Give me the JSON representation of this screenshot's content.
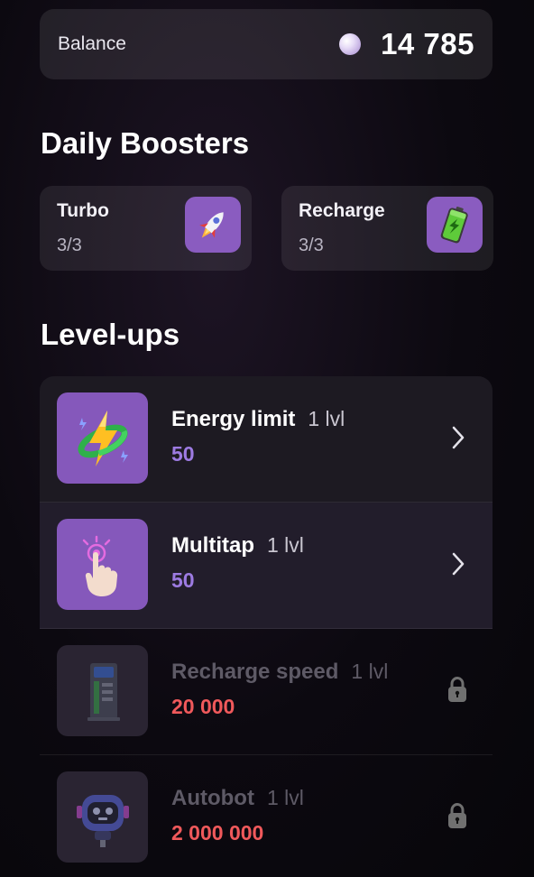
{
  "balance": {
    "label": "Balance",
    "value": "14 785",
    "coin_icon": "pearl-coin-icon"
  },
  "daily_boosters": {
    "title": "Daily Boosters",
    "items": [
      {
        "name": "Turbo",
        "count": "3/3",
        "icon": "rocket-icon"
      },
      {
        "name": "Recharge",
        "count": "3/3",
        "icon": "battery-icon"
      }
    ]
  },
  "level_ups": {
    "title": "Level-ups",
    "items": [
      {
        "name": "Energy limit",
        "level": "1 lvl",
        "cost": "50",
        "locked": false,
        "icon": "lightning-ring-icon"
      },
      {
        "name": "Multitap",
        "level": "1 lvl",
        "cost": "50",
        "locked": false,
        "icon": "tapping-hand-icon"
      },
      {
        "name": "Recharge speed",
        "level": "1 lvl",
        "cost": "20 000",
        "locked": true,
        "icon": "charging-station-icon"
      },
      {
        "name": "Autobot",
        "level": "1 lvl",
        "cost": "2 000 000",
        "locked": true,
        "icon": "robot-icon"
      }
    ]
  },
  "colors": {
    "accent_purple": "#9d7be2",
    "locked_cost_red": "#f0595b",
    "icon_tile": "#8558bb"
  }
}
